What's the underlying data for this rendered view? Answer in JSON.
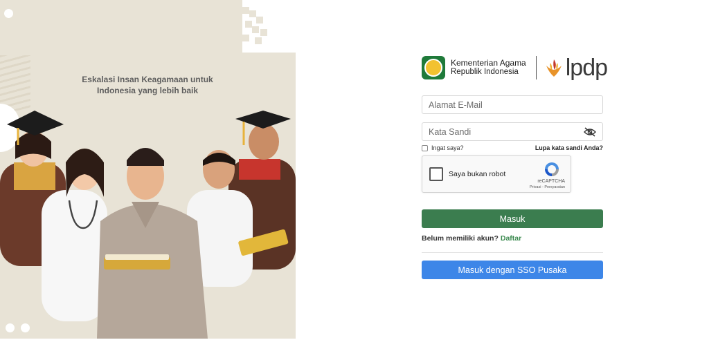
{
  "hero": {
    "tagline_line1": "Eskalasi Insan Keagamaan untuk",
    "tagline_line2": "Indonesia yang lebih baik",
    "background_color": "#e8e3d6"
  },
  "logo": {
    "kemenag_line1": "Kementerian Agama",
    "kemenag_line2": "Republik Indonesia",
    "lpdp": "lpdp",
    "kemenag_icon": "kemenag-emblem-icon",
    "lpdp_icon": "lpdp-flame-icon"
  },
  "form": {
    "email_placeholder": "Alamat E-Mail",
    "email_value": "",
    "password_placeholder": "Kata Sandi",
    "password_value": "",
    "password_toggle_icon": "eye-slash-icon",
    "remember_label": "Ingat saya?",
    "forgot_label": "Lupa kata sandi Anda?",
    "recaptcha_label": "Saya bukan robot",
    "recaptcha_brand": "reCAPTCHA",
    "recaptcha_links": "Privasi - Persyaratan",
    "login_button": "Masuk",
    "signup_prompt": "Belum memiliki akun?",
    "signup_link": "Daftar",
    "sso_button": "Masuk dengan SSO Pusaka"
  },
  "colors": {
    "login_button": "#3b7d4f",
    "sso_button": "#3d86e8",
    "signup_link": "#3b8a4f",
    "kemenag_green": "#1f7a3a",
    "lpdp_orange": "#e8932a"
  }
}
